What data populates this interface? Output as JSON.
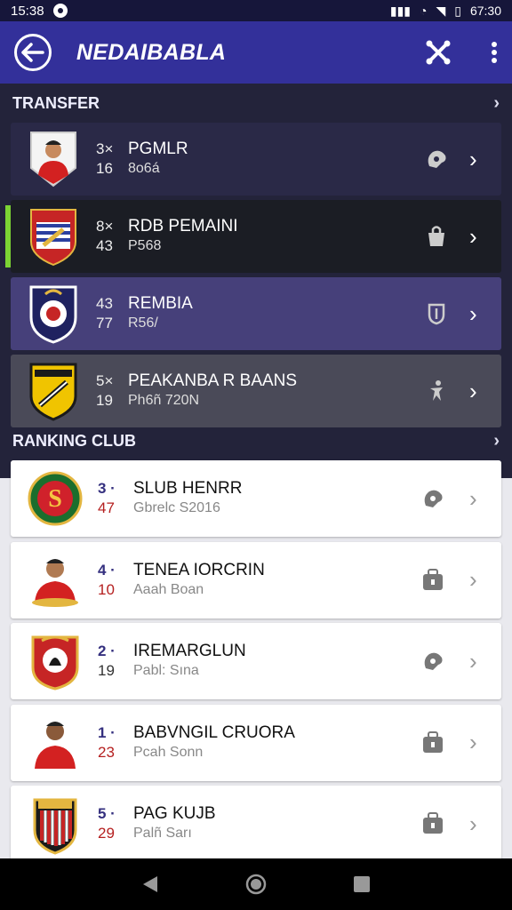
{
  "status_bar": {
    "time_left": "15:38",
    "time_right": "67:30"
  },
  "app_bar": {
    "title": "NEDAIBABLA"
  },
  "transfer": {
    "header": "TRANSFER",
    "items": [
      {
        "num1": "3×",
        "num2": "16",
        "name": "PGMLR",
        "sub": "8o6á",
        "icon": "hand-icon",
        "bg": "#2a2947"
      },
      {
        "num1": "8×",
        "num2": "43",
        "name": "RDB PEMAINI",
        "sub": "P568",
        "icon": "bag-icon",
        "bg": "#1b1d24"
      },
      {
        "num1": "43",
        "num2": "77",
        "name": "REMBIA",
        "sub": "R56/",
        "icon": "shield-icon",
        "bg": "#46407a"
      },
      {
        "num1": "5×",
        "num2": "19",
        "name": "PEAKANBA R BAANS",
        "sub": "Ph6ñ 720N",
        "icon": "player-icon",
        "bg": "#4a4a58"
      }
    ]
  },
  "ranking": {
    "header": "RANKING CLUB",
    "items": [
      {
        "num1": "3 ·",
        "num2": "47",
        "name": "SLUB HENRR",
        "sub": "Gbrelc S2016",
        "icon": "hand-icon"
      },
      {
        "num1": "4 ·",
        "num2": "10",
        "name": "TENEA IORCRIN",
        "sub": "Aaah Boan",
        "icon": "bag-icon"
      },
      {
        "num1": "2 ·",
        "num2": "19",
        "name": "IREMARGLUN",
        "sub": "Pabl: Sına",
        "icon": "hand-icon"
      },
      {
        "num1": "1 ·",
        "num2": "23",
        "name": "BABVNGIL CRUORA",
        "sub": "Pcah Sonn",
        "icon": "bag-icon"
      },
      {
        "num1": "5 ·",
        "num2": "29",
        "name": "PAG KUJB",
        "sub": "Palñ Sarı",
        "icon": "bag-icon"
      }
    ]
  }
}
